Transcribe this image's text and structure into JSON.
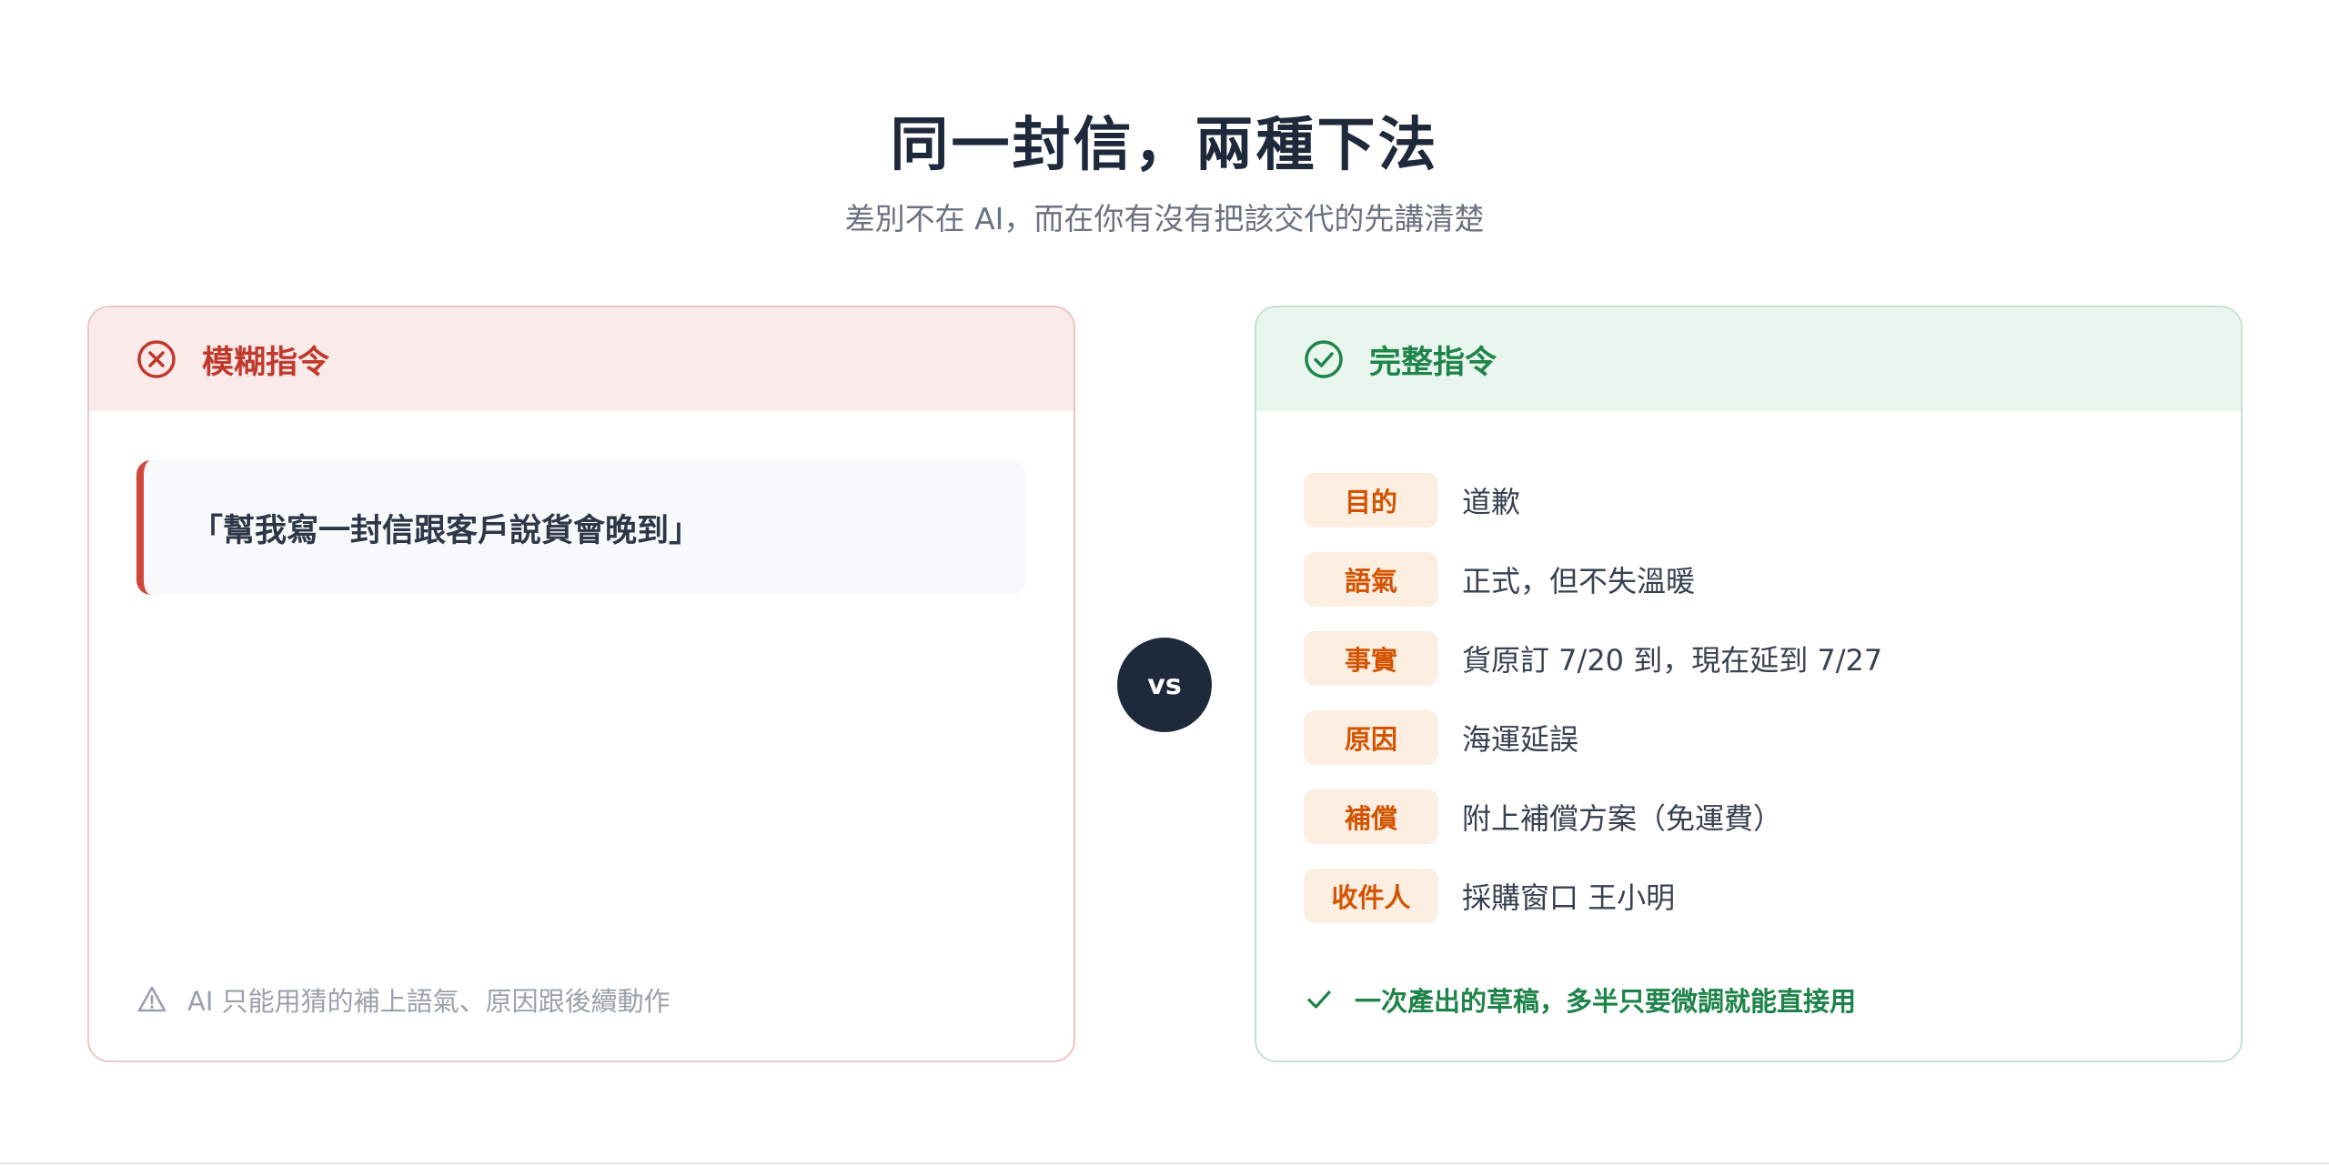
{
  "header": {
    "title": "同一封信，兩種下法",
    "subtitle": "差別不在 AI，而在你有沒有把該交代的先講清楚"
  },
  "colors": {
    "bad_accent": "#c0392b",
    "good_accent": "#1e8449",
    "tag_text": "#d35400",
    "vs_bg": "#1e293b"
  },
  "vague_card": {
    "icon": "x-circle-icon",
    "label": "模糊指令",
    "prompt": "「幫我寫一封信跟客戶說貨會晚到」",
    "warning_icon": "warning-triangle-icon",
    "warning": "AI 只能用猜的補上語氣、原因跟後續動作"
  },
  "vs_label": "vs",
  "complete_card": {
    "icon": "check-circle-icon",
    "label": "完整指令",
    "rows": [
      {
        "tag": "目的",
        "value": "道歉"
      },
      {
        "tag": "語氣",
        "value": "正式，但不失溫暖"
      },
      {
        "tag": "事實",
        "value": "貨原訂 7/20 到，現在延到 7/27"
      },
      {
        "tag": "原因",
        "value": "海運延誤"
      },
      {
        "tag": "補償",
        "value": "附上補償方案（免運費）"
      },
      {
        "tag": "收件人",
        "value": "採購窗口 王小明"
      }
    ],
    "result_icon": "check-icon",
    "result": "一次產出的草稿，多半只要微調就能直接用"
  }
}
